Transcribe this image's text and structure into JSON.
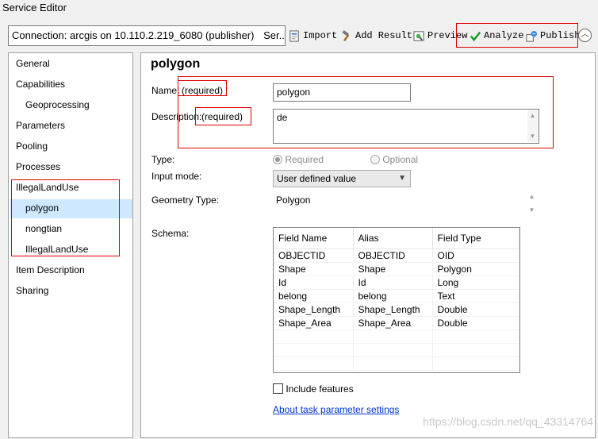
{
  "window": {
    "title": "Service Editor"
  },
  "toolbar": {
    "connection": "Connection: arcgis on 10.110.2.219_6080 (publisher)",
    "connection_more": "Ser...",
    "import_label": "Import",
    "add_result_label": "Add Result",
    "preview_label": "Preview",
    "analyze_label": "Analyze",
    "publish_label": "Publish"
  },
  "sidebar": {
    "items": [
      {
        "label": "General"
      },
      {
        "label": "Capabilities"
      },
      {
        "label": "Geoprocessing"
      },
      {
        "label": "Parameters"
      },
      {
        "label": "Pooling"
      },
      {
        "label": "Processes"
      },
      {
        "label": "IllegalLandUse"
      },
      {
        "label": "polygon"
      },
      {
        "label": "nongtian"
      },
      {
        "label": "IllegalLandUse"
      },
      {
        "label": "Item Description"
      },
      {
        "label": "Sharing"
      }
    ],
    "selected": "polygon"
  },
  "main": {
    "title": "polygon",
    "name_label": "Name:",
    "name_required": "(required)",
    "name_value": "polygon",
    "desc_label": "Description:",
    "desc_required": "(required)",
    "desc_value": "de",
    "type_label": "Type:",
    "type_required": "Required",
    "type_optional": "Optional",
    "input_mode_label": "Input mode:",
    "input_mode_value": "User defined value",
    "geom_label": "Geometry Type:",
    "geom_value": "Polygon",
    "schema_label": "Schema:",
    "schema": {
      "headers": [
        "Field Name",
        "Alias",
        "Field Type"
      ],
      "rows": [
        [
          "OBJECTID",
          "OBJECTID",
          "OID"
        ],
        [
          "Shape",
          "Shape",
          "Polygon"
        ],
        [
          "Id",
          "Id",
          "Long"
        ],
        [
          "belong",
          "belong",
          "Text"
        ],
        [
          "Shape_Length",
          "Shape_Length",
          "Double"
        ],
        [
          "Shape_Area",
          "Shape_Area",
          "Double"
        ]
      ]
    },
    "include_features": "Include features",
    "about_link": "About task parameter settings"
  },
  "watermark": "https://blog.csdn.net/qq_43314764",
  "colors": {
    "highlight_red": "#e00000",
    "selection": "#cde8ff",
    "link": "#0033cc"
  }
}
